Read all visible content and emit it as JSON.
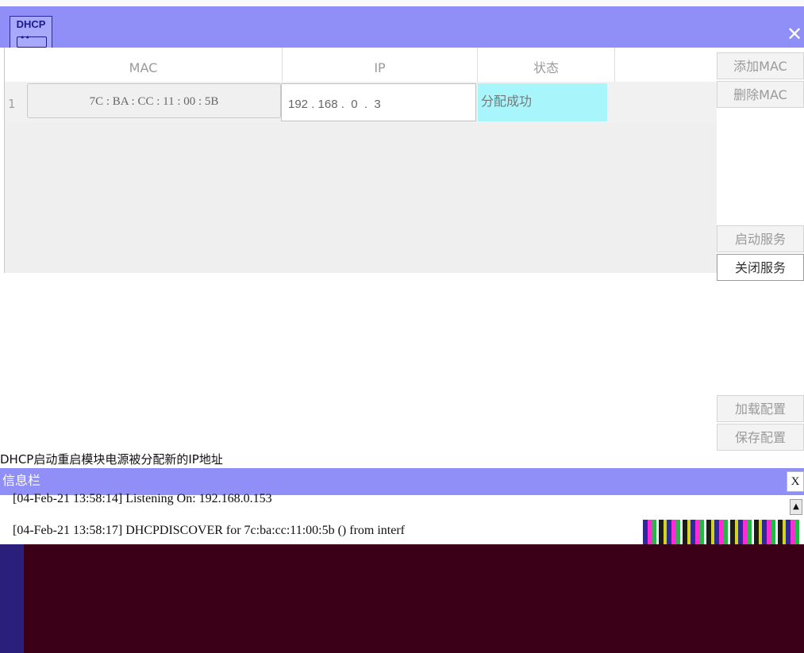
{
  "window": {
    "logo_text": "DHCP",
    "close_label": "✕"
  },
  "table": {
    "columns": [
      "MAC",
      "IP",
      "状态"
    ],
    "rows": [
      {
        "index": "1",
        "mac": "7C : BA : CC : 11 : 00 : 5B",
        "ip": "192 . 168 .  0  .  3",
        "status": "分配成功"
      }
    ]
  },
  "sidebar": {
    "add_mac": "添加MAC",
    "delete_mac": "删除MAC",
    "start_service": "启动服务",
    "stop_service": "关闭服务",
    "load_config": "加载配置",
    "save_config": "保存配置"
  },
  "status_line": "DHCP启动重启模块电源被分配新的IP地址",
  "info": {
    "title": "信息栏",
    "close_label": "X",
    "logs": [
      "[04-Feb-21 13:58:14] Listening On: 192.168.0.153",
      "[04-Feb-21 13:58:17] DHCPDISCOVER for 7c:ba:cc:11:00:5b () from interf"
    ]
  },
  "colors": {
    "title_bar": "#8f8ff7",
    "status_success": "#a8f6fb",
    "dark_region": "#3b0018"
  }
}
